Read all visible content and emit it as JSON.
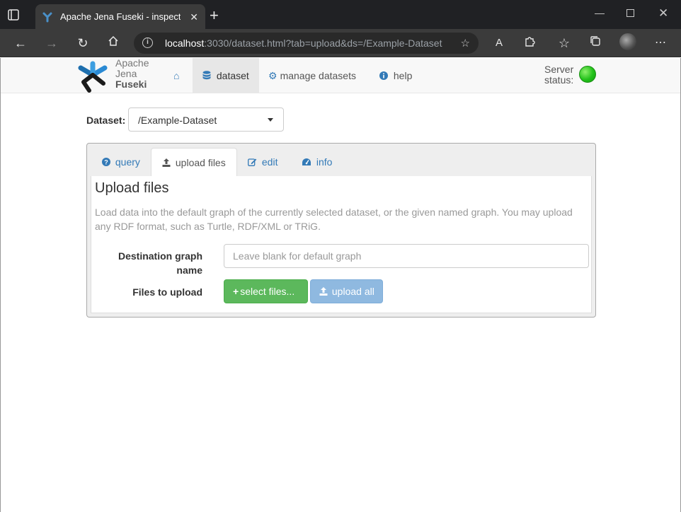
{
  "browser": {
    "tab_title": "Apache Jena Fuseki - inspect dat",
    "url_host": "localhost",
    "url_rest": ":3030/dataset.html?tab=upload&ds=/Example-Dataset"
  },
  "navbar": {
    "logo_line1": "Apache",
    "logo_line2": "Jena",
    "logo_line3": "Fuseki",
    "items": [
      {
        "label": "dataset",
        "icon": "database-icon"
      },
      {
        "label": "manage datasets",
        "icon": "cogs-icon"
      },
      {
        "label": "help",
        "icon": "info-icon"
      }
    ],
    "server_status_label1": "Server",
    "server_status_label2": "status:",
    "status_color": "#22c11a"
  },
  "dataset": {
    "label": "Dataset:",
    "selected": "/Example-Dataset"
  },
  "tabs": [
    {
      "label": "query",
      "icon": "question-circle-icon"
    },
    {
      "label": "upload files",
      "icon": "upload-icon"
    },
    {
      "label": "edit",
      "icon": "edit-icon"
    },
    {
      "label": "info",
      "icon": "dashboard-icon"
    }
  ],
  "upload": {
    "heading": "Upload files",
    "help": "Load data into the default graph of the currently selected dataset, or the given named graph. You may upload any RDF format, such as Turtle, RDF/XML or TRiG.",
    "dest_label_line1": "Destination graph",
    "dest_label_line2": "name",
    "dest_placeholder": "Leave blank for default graph",
    "files_label": "Files to upload",
    "select_button": "select files...",
    "upload_button": "upload all"
  },
  "colors": {
    "link": "#337ab7",
    "success": "#5cb85c",
    "primary_disabled": "#8fb9e0"
  }
}
